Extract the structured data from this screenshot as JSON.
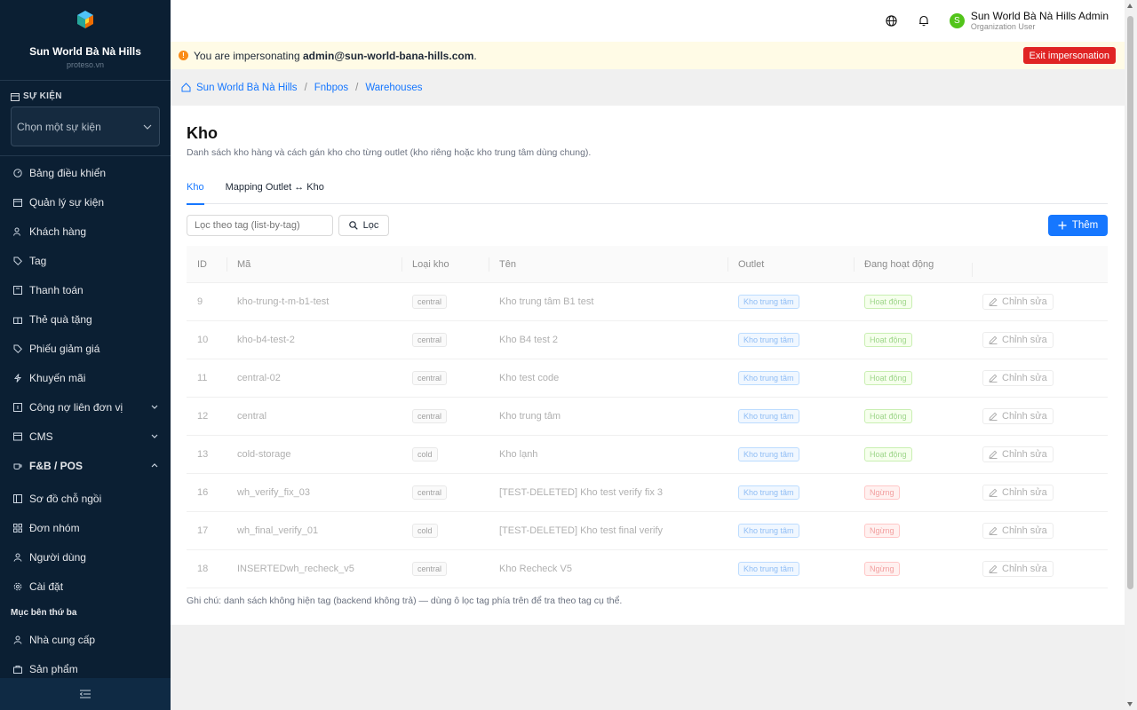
{
  "colors": {
    "sidebar_bg": "#0b1f33",
    "primary": "#1677ff",
    "danger": "#e02424",
    "warning_bg": "#fffbe6",
    "avatar_bg": "#52c41a"
  },
  "brand": {
    "name": "Sun World Bà Nà Hills",
    "sub": "proteso.vn",
    "logo_icon": "cube-logo-icon"
  },
  "event_section": {
    "title": "SỰ KIỆN",
    "icon": "calendar-icon",
    "select_value": "Chọn một sự kiện"
  },
  "nav": [
    {
      "label": "Bảng điều khiển",
      "icon": "dashboard-icon"
    },
    {
      "label": "Quản lý sự kiện",
      "icon": "calendar-icon"
    },
    {
      "label": "Khách hàng",
      "icon": "users-icon"
    },
    {
      "label": "Tag",
      "icon": "tag-icon"
    },
    {
      "label": "Thanh toán",
      "icon": "payment-icon"
    },
    {
      "label": "Thẻ quà tặng",
      "icon": "gift-icon"
    },
    {
      "label": "Phiếu giảm giá",
      "icon": "coupon-icon"
    },
    {
      "label": "Khuyến mãi",
      "icon": "bolt-icon"
    },
    {
      "label": "Công nợ liên đơn vị",
      "icon": "ledger-icon"
    },
    {
      "label": "CMS",
      "icon": "cms-icon"
    },
    {
      "label": "F&B / POS",
      "icon": "coffee-icon"
    },
    {
      "label": "Sơ đồ chỗ ngồi",
      "icon": "seat-map-icon"
    },
    {
      "label": "Đơn nhóm",
      "icon": "grid-icon"
    },
    {
      "label": "Người dùng",
      "icon": "user-icon"
    },
    {
      "label": "Cài đặt",
      "icon": "gear-icon"
    }
  ],
  "third_party": {
    "label": "Mục bên thứ ba",
    "items": [
      {
        "label": "Nhà cung cấp",
        "icon": "supplier-icon"
      },
      {
        "label": "Sản phẩm",
        "icon": "bag-icon"
      }
    ]
  },
  "header": {
    "user_name": "Sun World Bà Nà Hills Admin",
    "user_role": "Organization User",
    "avatar_letter": "S"
  },
  "impersonation": {
    "prefix": "You are impersonating",
    "email": "admin@sun-world-bana-hills.com",
    "suffix": ".",
    "exit_label": "Exit impersonation"
  },
  "breadcrumb": [
    "Sun World Bà Nà Hills",
    "Fnbpos",
    "Warehouses"
  ],
  "page": {
    "title": "Kho",
    "description": "Danh sách kho hàng và cách gán kho cho từng outlet (kho riêng hoặc kho trung tâm dùng chung).",
    "tabs": [
      "Kho",
      "Mapping Outlet ↔ Kho"
    ],
    "filter_placeholder": "Lọc theo tag (list-by-tag)",
    "filter_button": "Lọc",
    "add_button": "Thêm",
    "note": "Ghi chú: danh sách không hiện tag (backend không trả) — dùng ô lọc tag phía trên để tra theo tag cụ thể."
  },
  "table": {
    "headers": [
      "ID",
      "Mã",
      "Loại kho",
      "Tên",
      "Outlet",
      "Đang hoạt động",
      ""
    ],
    "edit_label": "Chỉnh sửa",
    "rows": [
      {
        "id": "9",
        "code": "kho-trung-t-m-b1-test",
        "type": "central",
        "name": "Kho trung tâm B1 test",
        "outlet": "Kho trung tâm",
        "status": "Hoạt động",
        "active": true
      },
      {
        "id": "10",
        "code": "kho-b4-test-2",
        "type": "central",
        "name": "Kho B4 test 2",
        "outlet": "Kho trung tâm",
        "status": "Hoạt động",
        "active": true
      },
      {
        "id": "11",
        "code": "central-02",
        "type": "central",
        "name": "Kho test code",
        "outlet": "Kho trung tâm",
        "status": "Hoạt động",
        "active": true
      },
      {
        "id": "12",
        "code": "central",
        "type": "central",
        "name": "Kho trung tâm",
        "outlet": "Kho trung tâm",
        "status": "Hoạt động",
        "active": true
      },
      {
        "id": "13",
        "code": "cold-storage",
        "type": "cold",
        "name": "Kho lạnh",
        "outlet": "Kho trung tâm",
        "status": "Hoạt động",
        "active": true
      },
      {
        "id": "16",
        "code": "wh_verify_fix_03",
        "type": "central",
        "name": "[TEST-DELETED] Kho test verify fix 3",
        "outlet": "Kho trung tâm",
        "status": "Ngừng",
        "active": false
      },
      {
        "id": "17",
        "code": "wh_final_verify_01",
        "type": "cold",
        "name": "[TEST-DELETED] Kho test final verify",
        "outlet": "Kho trung tâm",
        "status": "Ngừng",
        "active": false
      },
      {
        "id": "18",
        "code": "INSERTEDwh_recheck_v5",
        "type": "central",
        "name": "Kho Recheck V5",
        "outlet": "Kho trung tâm",
        "status": "Ngừng",
        "active": false
      }
    ]
  }
}
